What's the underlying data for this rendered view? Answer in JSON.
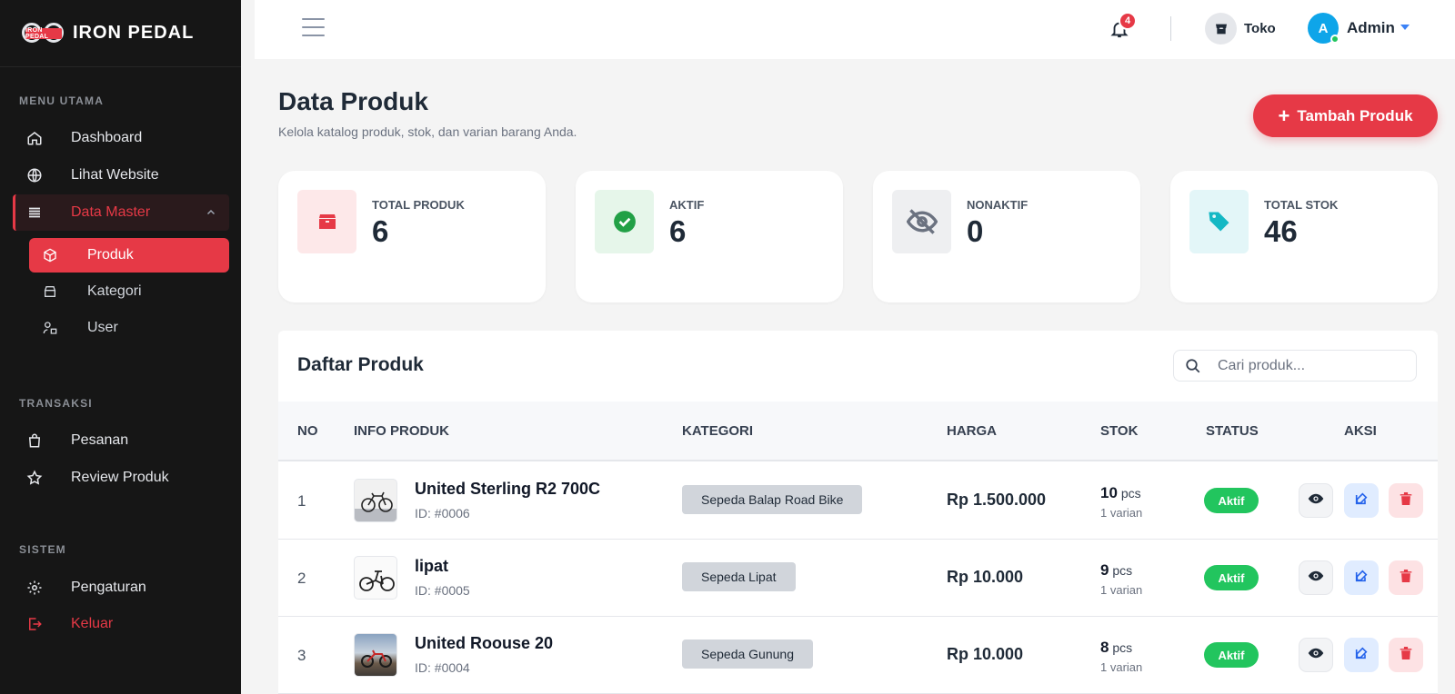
{
  "brand": {
    "name": "IRON PEDAL",
    "logo_text": "IRON PEDAL"
  },
  "sidebar": {
    "sections": {
      "main": "MENU UTAMA",
      "transaksi": "TRANSAKSI",
      "sistem": "SISTEM"
    },
    "items": {
      "dashboard": "Dashboard",
      "website": "Lihat Website",
      "data_master": "Data Master",
      "produk": "Produk",
      "kategori": "Kategori",
      "user": "User",
      "pesanan": "Pesanan",
      "review": "Review Produk",
      "pengaturan": "Pengaturan",
      "keluar": "Keluar"
    }
  },
  "topbar": {
    "notif_count": "4",
    "store_label": "Toko",
    "avatar_initial": "A",
    "admin_label": "Admin"
  },
  "header": {
    "title": "Data Produk",
    "subtitle": "Kelola katalog produk, stok, dan varian barang Anda.",
    "add_button": "Tambah Produk"
  },
  "stats": [
    {
      "label": "TOTAL PRODUK",
      "value": "6",
      "icon": "box-icon",
      "color": "#e63946",
      "bg": "#fde8e9"
    },
    {
      "label": "AKTIF",
      "value": "6",
      "icon": "check-circle-icon",
      "color": "#22a046",
      "bg": "#e6f6ea"
    },
    {
      "label": "NONAKTIF",
      "value": "0",
      "icon": "eye-slash-icon",
      "color": "#6b7280",
      "bg": "#eeeff1"
    },
    {
      "label": "TOTAL STOK",
      "value": "46",
      "icon": "tags-icon",
      "color": "#14b8c4",
      "bg": "#e3f6f8"
    }
  ],
  "table": {
    "title": "Daftar Produk",
    "search_placeholder": "Cari produk...",
    "columns": [
      "NO",
      "INFO PRODUK",
      "KATEGORI",
      "HARGA",
      "STOK",
      "STATUS",
      "AKSI"
    ],
    "rows": [
      {
        "no": "1",
        "name": "United Sterling R2 700C",
        "id": "ID: #0006",
        "category": "Sepeda Balap Road Bike",
        "price": "Rp 1.500.000",
        "stock": "10",
        "unit": "pcs",
        "variants": "1 varian",
        "status": "Aktif"
      },
      {
        "no": "2",
        "name": "lipat",
        "id": "ID: #0005",
        "category": "Sepeda Lipat",
        "price": "Rp 10.000",
        "stock": "9",
        "unit": "pcs",
        "variants": "1 varian",
        "status": "Aktif"
      },
      {
        "no": "3",
        "name": "United Roouse 20",
        "id": "ID: #0004",
        "category": "Sepeda Gunung",
        "price": "Rp 10.000",
        "stock": "8",
        "unit": "pcs",
        "variants": "1 varian",
        "status": "Aktif"
      }
    ]
  },
  "colors": {
    "accent": "#e63946",
    "sidebar_bg": "#161616",
    "active_status": "#22c55e"
  }
}
